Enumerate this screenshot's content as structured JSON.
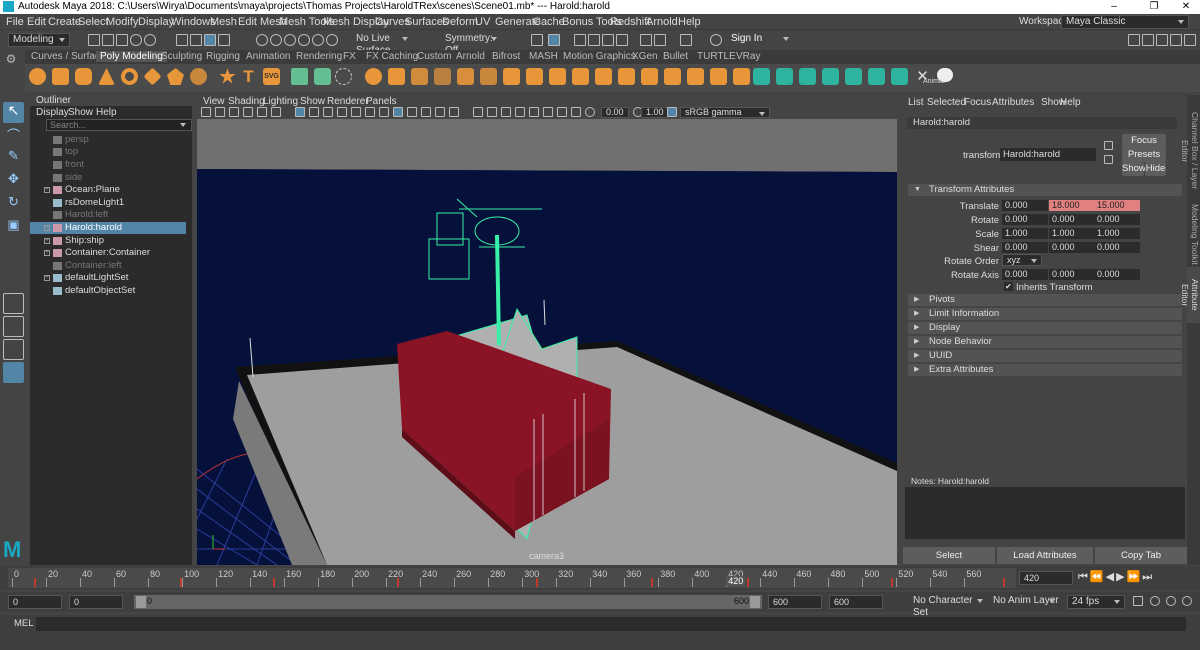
{
  "window": {
    "title": "Autodesk Maya 2018: C:\\Users\\Wirya\\Documents\\maya\\projects\\Thomas Projects\\HaroldTRex\\scenes\\Scene01.mb*  ---  Harold:harold",
    "min": "–",
    "max": "❐",
    "close": "✕"
  },
  "menubar": {
    "items": [
      "File",
      "Edit",
      "Create",
      "Select",
      "Modify",
      "Display",
      "Windows",
      "Mesh",
      "Edit Mesh",
      "Mesh Tools",
      "Mesh Display",
      "Curves",
      "Surfaces",
      "Deform",
      "UV",
      "Generate",
      "Cache",
      "Bonus Tools",
      "Redshift",
      "Arnold",
      "Help"
    ],
    "workspace_label": "Workspace :",
    "workspace_value": "Maya Classic"
  },
  "statusline": {
    "menuset": "Modeling",
    "live_surface": "No Live Surface",
    "symmetry": "Symmetry: Off",
    "signin": "Sign In"
  },
  "shelf": {
    "tabs": [
      "Curves / Surfaces",
      "Poly Modeling",
      "Sculpting",
      "Rigging",
      "Animation",
      "Rendering",
      "FX",
      "FX Caching",
      "Custom",
      "Arnold",
      "Bifrost",
      "MASH",
      "Motion Graphics",
      "XGen",
      "Bullet",
      "TURTLE",
      "VRay"
    ],
    "active_tab": "Poly Modeling",
    "last_label": "Animat",
    "T_label": "T",
    "svg_label": "SVG"
  },
  "outliner": {
    "title": "Outliner",
    "menu": [
      "Display",
      "Show",
      "Help"
    ],
    "search_placeholder": "Search...",
    "items": [
      {
        "label": "persp",
        "dim": true,
        "expand": false
      },
      {
        "label": "top",
        "dim": true,
        "expand": false
      },
      {
        "label": "front",
        "dim": true,
        "expand": false
      },
      {
        "label": "side",
        "dim": true,
        "expand": false
      },
      {
        "label": "Ocean:Plane",
        "dim": false,
        "expand": true
      },
      {
        "label": "rsDomeLight1",
        "dim": false,
        "expand": false
      },
      {
        "label": "Harold:left",
        "dim": true,
        "expand": false
      },
      {
        "label": "Harold:harold",
        "dim": false,
        "expand": true,
        "selected": true
      },
      {
        "label": "Ship:ship",
        "dim": false,
        "expand": true
      },
      {
        "label": "Container:Container",
        "dim": false,
        "expand": true
      },
      {
        "label": "Container:left",
        "dim": true,
        "expand": false
      },
      {
        "label": "defaultLightSet",
        "dim": false,
        "expand": true
      },
      {
        "label": "defaultObjectSet",
        "dim": false,
        "expand": false
      }
    ]
  },
  "viewport": {
    "menu": [
      "View",
      "Shading",
      "Lighting",
      "Show",
      "Renderer",
      "Panels"
    ],
    "exposure": "0.00",
    "gamma": "1.00",
    "colorspace": "sRGB gamma",
    "camera_label": "camera3"
  },
  "attribute_editor": {
    "menu": [
      "List",
      "Selected",
      "Focus",
      "Attributes",
      "Show",
      "Help"
    ],
    "tab": "Harold:harold",
    "transform_label": "transform:",
    "transform_value": "Harold:harold",
    "buttons": {
      "focus": "Focus",
      "presets": "Presets",
      "show": "Show",
      "hide": "Hide"
    },
    "section_title": "Transform Attributes",
    "rows": [
      {
        "label": "Translate",
        "values": [
          "0.000",
          "18.000",
          "15.000"
        ]
      },
      {
        "label": "Rotate",
        "values": [
          "0.000",
          "0.000",
          "0.000"
        ]
      },
      {
        "label": "Scale",
        "values": [
          "1.000",
          "1.000",
          "1.000"
        ]
      },
      {
        "label": "Shear",
        "values": [
          "0.000",
          "0.000",
          "0.000"
        ]
      }
    ],
    "rotate_order_label": "Rotate Order",
    "rotate_order_value": "xyz",
    "rotate_axis_label": "Rotate Axis",
    "rotate_axis_values": [
      "0.000",
      "0.000",
      "0.000"
    ],
    "inherits_label": "Inherits Transform",
    "collapsed_sections": [
      "Pivots",
      "Limit Information",
      "Display",
      "Node Behavior",
      "UUID",
      "Extra Attributes"
    ],
    "notes_label": "Notes:  Harold:harold",
    "bottom_buttons": [
      "Select",
      "Load Attributes",
      "Copy Tab"
    ],
    "side_tabs": [
      "Channel Box / Layer Editor",
      "Modeling Toolkit",
      "Attribute Editor"
    ]
  },
  "timeline": {
    "ticks": [
      "0",
      "20",
      "40",
      "60",
      "80",
      "100",
      "120",
      "140",
      "160",
      "180",
      "200",
      "220",
      "240",
      "260",
      "280",
      "300",
      "320",
      "340",
      "360",
      "380",
      "400",
      "420",
      "440",
      "460",
      "480",
      "500",
      "520",
      "540",
      "560"
    ],
    "current_marker": "420",
    "current_frame": "420"
  },
  "rangebar": {
    "start": "0",
    "start2": "0",
    "slider_start": "0",
    "slider_end": "600",
    "end": "600",
    "end2": "600",
    "character_set": "No Character Set",
    "anim_layer": "No Anim Layer",
    "fps": "24 fps"
  },
  "mel": {
    "label": "MEL"
  },
  "colors": {
    "accent": "#5285a6",
    "selection_green": "#38f0a8",
    "container_red": "#8a1426",
    "viewport_bg": "#06113b",
    "keyframe_red": "#c0392b"
  }
}
